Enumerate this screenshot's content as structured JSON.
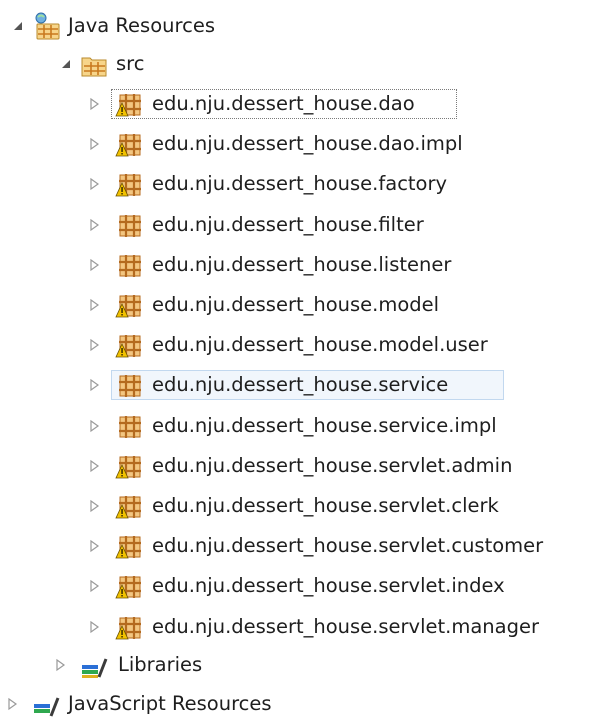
{
  "tree": {
    "root": {
      "label": "Java Resources",
      "icon": "java-resources-icon",
      "expanded": true
    },
    "src": {
      "label": "src",
      "icon": "source-folder-icon",
      "expanded": true
    },
    "packages": [
      {
        "label": "edu.nju.dessert_house.dao",
        "icon": "package-icon",
        "warning": true,
        "state": "focused"
      },
      {
        "label": "edu.nju.dessert_house.dao.impl",
        "icon": "package-icon",
        "warning": true,
        "state": "normal"
      },
      {
        "label": "edu.nju.dessert_house.factory",
        "icon": "package-icon",
        "warning": true,
        "state": "normal"
      },
      {
        "label": "edu.nju.dessert_house.filter",
        "icon": "package-icon",
        "warning": false,
        "state": "normal"
      },
      {
        "label": "edu.nju.dessert_house.listener",
        "icon": "package-icon",
        "warning": false,
        "state": "normal"
      },
      {
        "label": "edu.nju.dessert_house.model",
        "icon": "package-icon",
        "warning": true,
        "state": "normal"
      },
      {
        "label": "edu.nju.dessert_house.model.user",
        "icon": "package-icon",
        "warning": true,
        "state": "normal"
      },
      {
        "label": "edu.nju.dessert_house.service",
        "icon": "package-icon",
        "warning": false,
        "state": "selected"
      },
      {
        "label": "edu.nju.dessert_house.service.impl",
        "icon": "package-icon",
        "warning": false,
        "state": "normal"
      },
      {
        "label": "edu.nju.dessert_house.servlet.admin",
        "icon": "package-icon",
        "warning": true,
        "state": "normal"
      },
      {
        "label": "edu.nju.dessert_house.servlet.clerk",
        "icon": "package-icon",
        "warning": true,
        "state": "normal"
      },
      {
        "label": "edu.nju.dessert_house.servlet.customer",
        "icon": "package-icon",
        "warning": true,
        "state": "normal"
      },
      {
        "label": "edu.nju.dessert_house.servlet.index",
        "icon": "package-icon",
        "warning": true,
        "state": "normal"
      },
      {
        "label": "edu.nju.dessert_house.servlet.manager",
        "icon": "package-icon",
        "warning": true,
        "state": "normal"
      }
    ],
    "libraries": {
      "label": "Libraries",
      "icon": "libraries-icon",
      "expanded": false
    },
    "next": {
      "label": "JavaScript Resources",
      "icon": "javascript-resources-icon",
      "expanded": false
    }
  },
  "colors": {
    "package": "#d9a24a",
    "package_dark": "#b46a1e",
    "warning": "#f2c200",
    "selection_bg": "#f1f6fc",
    "selection_border": "#c2d8ef",
    "text": "#1e1e1e"
  }
}
